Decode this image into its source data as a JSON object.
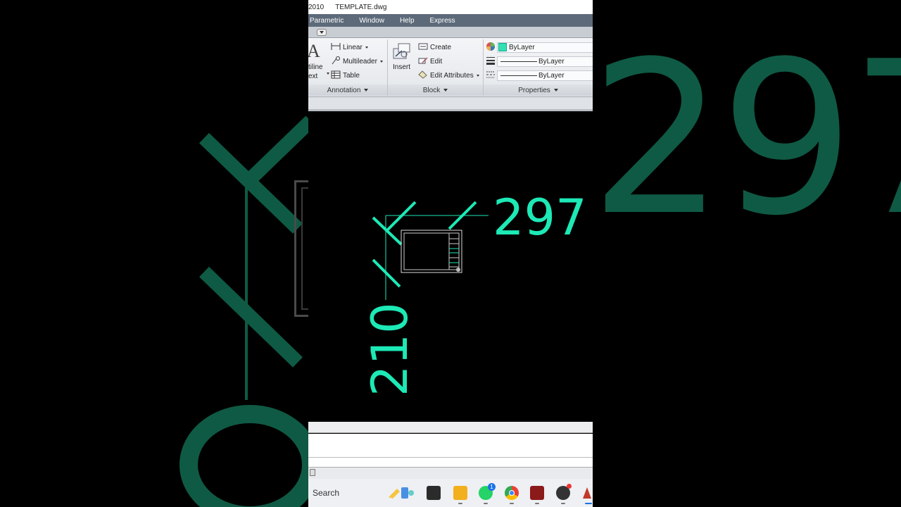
{
  "window": {
    "title_left": "2010",
    "title_file": "TEMPLATE.dwg"
  },
  "menu": [
    "Parametric",
    "Window",
    "Help",
    "Express"
  ],
  "ribbon": {
    "annotation": {
      "text_partial_1": "tiline",
      "text_partial_2": "ext",
      "linear": "Linear",
      "multileader": "Multileader",
      "table": "Table",
      "panel_title": "Annotation"
    },
    "block": {
      "insert": "Insert",
      "create": "Create",
      "edit": "Edit",
      "edit_attributes": "Edit Attributes",
      "panel_title": "Block"
    },
    "properties": {
      "color": "ByLayer",
      "linetype": "ByLayer",
      "lineweight": "ByLayer",
      "panel_title": "Properties",
      "color_swatch": "#33e0b0"
    }
  },
  "drawing": {
    "dim_horizontal": "297",
    "dim_vertical": "210",
    "accent": "#1de9b6"
  },
  "background": {
    "blur_number": "297"
  },
  "taskbar": {
    "search_placeholder": "Search",
    "whatsapp_badge": "1"
  }
}
